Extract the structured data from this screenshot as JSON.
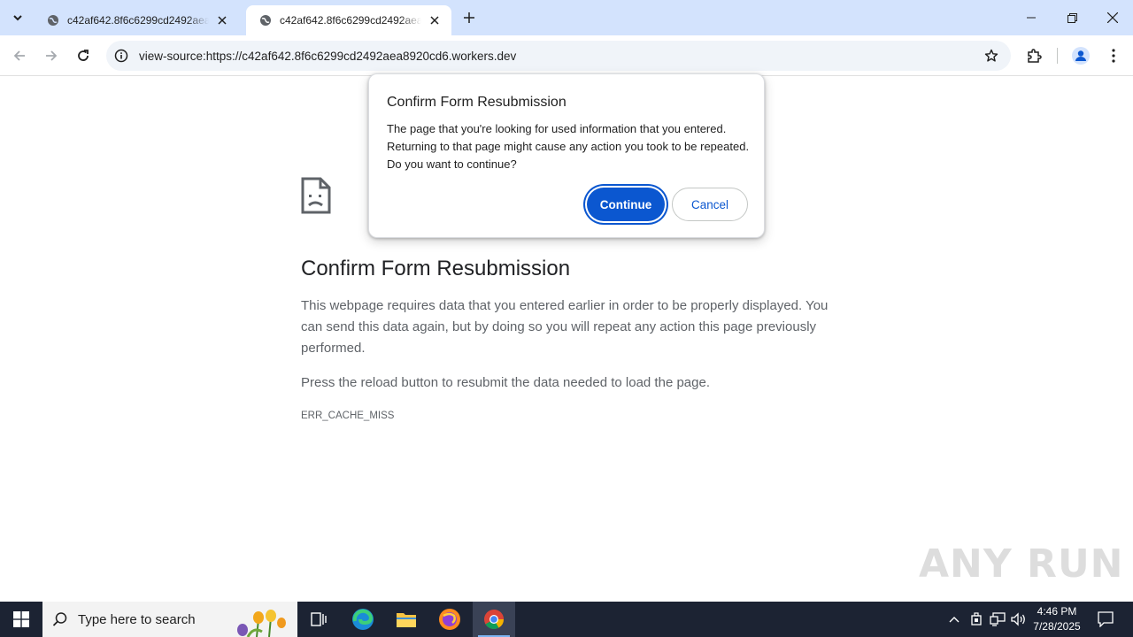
{
  "browser": {
    "tabs": [
      {
        "title": "c42af642.8f6c6299cd2492aea8920cd6.workers.dev",
        "active": false
      },
      {
        "title": "c42af642.8f6c6299cd2492aea8920cd6.workers.dev",
        "active": true
      }
    ],
    "url": "view-source:https://c42af642.8f6c6299cd2492aea8920cd6.workers.dev"
  },
  "error_page": {
    "title": "Confirm Form Resubmission",
    "description": "This webpage requires data that you entered earlier in order to be properly displayed. You can send this data again, but by doing so you will repeat any action this page previously performed.",
    "reload_hint": "Press the reload button to resubmit the data needed to load the page.",
    "error_code": "ERR_CACHE_MISS"
  },
  "dialog": {
    "title": "Confirm Form Resubmission",
    "body": "The page that you're looking for used information that you entered. Returning to that page might cause any action you took to be repeated. Do you want to continue?",
    "continue_label": "Continue",
    "cancel_label": "Cancel"
  },
  "watermark": "ANY RUN",
  "taskbar": {
    "search_placeholder": "Type here to search",
    "time": "4:46 PM",
    "date": "7/28/2025",
    "apps": [
      "task-view",
      "edge",
      "file-explorer",
      "firefox",
      "chrome"
    ]
  },
  "colors": {
    "tabstrip": "#d3e3fd",
    "accent": "#0b57d0",
    "taskbar": "#1c2333"
  }
}
